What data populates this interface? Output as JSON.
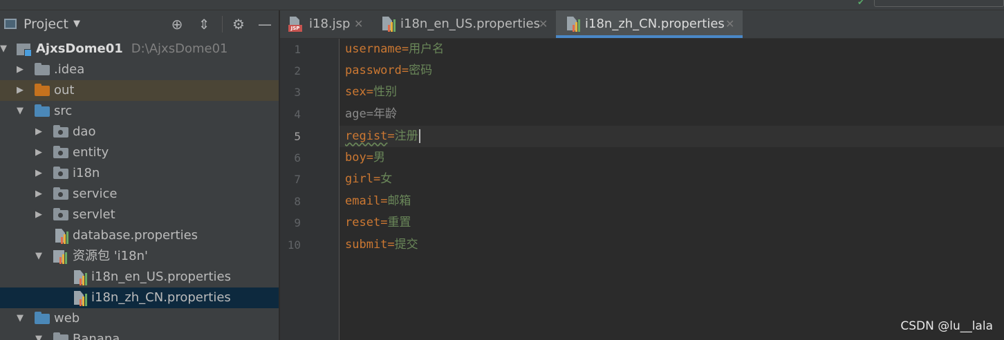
{
  "project_panel": {
    "title": "Project",
    "tree": [
      {
        "label": "AjxsDome01",
        "path": "D:\\AjxsDome01"
      },
      {
        "label": ".idea"
      },
      {
        "label": "out"
      },
      {
        "label": "src"
      },
      {
        "label": "dao"
      },
      {
        "label": "entity"
      },
      {
        "label": "i18n"
      },
      {
        "label": "service"
      },
      {
        "label": "servlet"
      },
      {
        "label": "database.properties"
      },
      {
        "label": "资源包 'i18n'"
      },
      {
        "label": "i18n_en_US.properties"
      },
      {
        "label": "i18n_zh_CN.properties"
      },
      {
        "label": "web"
      },
      {
        "label": "Banana"
      }
    ]
  },
  "tabs": [
    {
      "label": "i18.jsp",
      "icon": "jsp-file-icon"
    },
    {
      "label": "i18n_en_US.properties",
      "icon": "properties-file-icon"
    },
    {
      "label": "i18n_zh_CN.properties",
      "icon": "properties-file-icon",
      "active": true
    }
  ],
  "editor": {
    "current_line": 5,
    "lines": [
      {
        "num": "1",
        "key": "username",
        "eq": "=",
        "value": "用户名"
      },
      {
        "num": "2",
        "key": "password",
        "eq": "=",
        "value": "密码"
      },
      {
        "num": "3",
        "key": "sex",
        "eq": "=",
        "value": "性别"
      },
      {
        "num": "4",
        "key": "age",
        "eq": "=",
        "value": "年龄"
      },
      {
        "num": "5",
        "key": "regist",
        "eq": "=",
        "value": "注册"
      },
      {
        "num": "6",
        "key": "boy",
        "eq": "=",
        "value": "男"
      },
      {
        "num": "7",
        "key": "girl",
        "eq": "=",
        "value": "女"
      },
      {
        "num": "8",
        "key": "email",
        "eq": "=",
        "value": "邮箱"
      },
      {
        "num": "9",
        "key": "reset",
        "eq": "=",
        "value": "重置"
      },
      {
        "num": "10",
        "key": "submit",
        "eq": "=",
        "value": "提交"
      }
    ]
  },
  "watermark": "CSDN @lu__lala",
  "colors": {
    "key": "#cc7832",
    "value": "#6a8759",
    "selection": "#0d293e",
    "active_tab_underline": "#4a88c7"
  }
}
